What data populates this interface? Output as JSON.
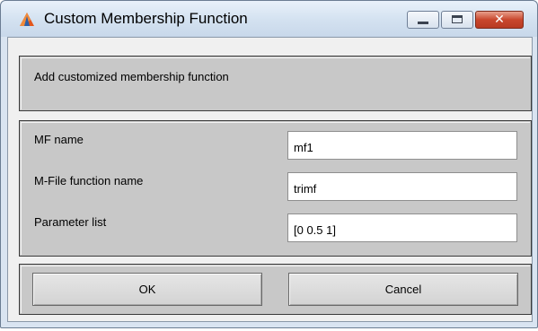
{
  "window": {
    "title": "Custom Membership Function",
    "app_icon": "matlab-icon",
    "controls": {
      "minimize": "minimize-icon",
      "maximize": "maximize-icon",
      "close": "close-icon",
      "close_glyph": "✕"
    }
  },
  "description": "Add customized membership function",
  "fields": [
    {
      "label": "MF name",
      "value": "mf1"
    },
    {
      "label": "M-File function name",
      "value": "trimf"
    },
    {
      "label": "Parameter list",
      "value": "[0 0.5 1]"
    }
  ],
  "buttons": {
    "ok": "OK",
    "cancel": "Cancel"
  },
  "colors": {
    "panel": "#c8c8c8",
    "close_button": "#c9472d"
  }
}
